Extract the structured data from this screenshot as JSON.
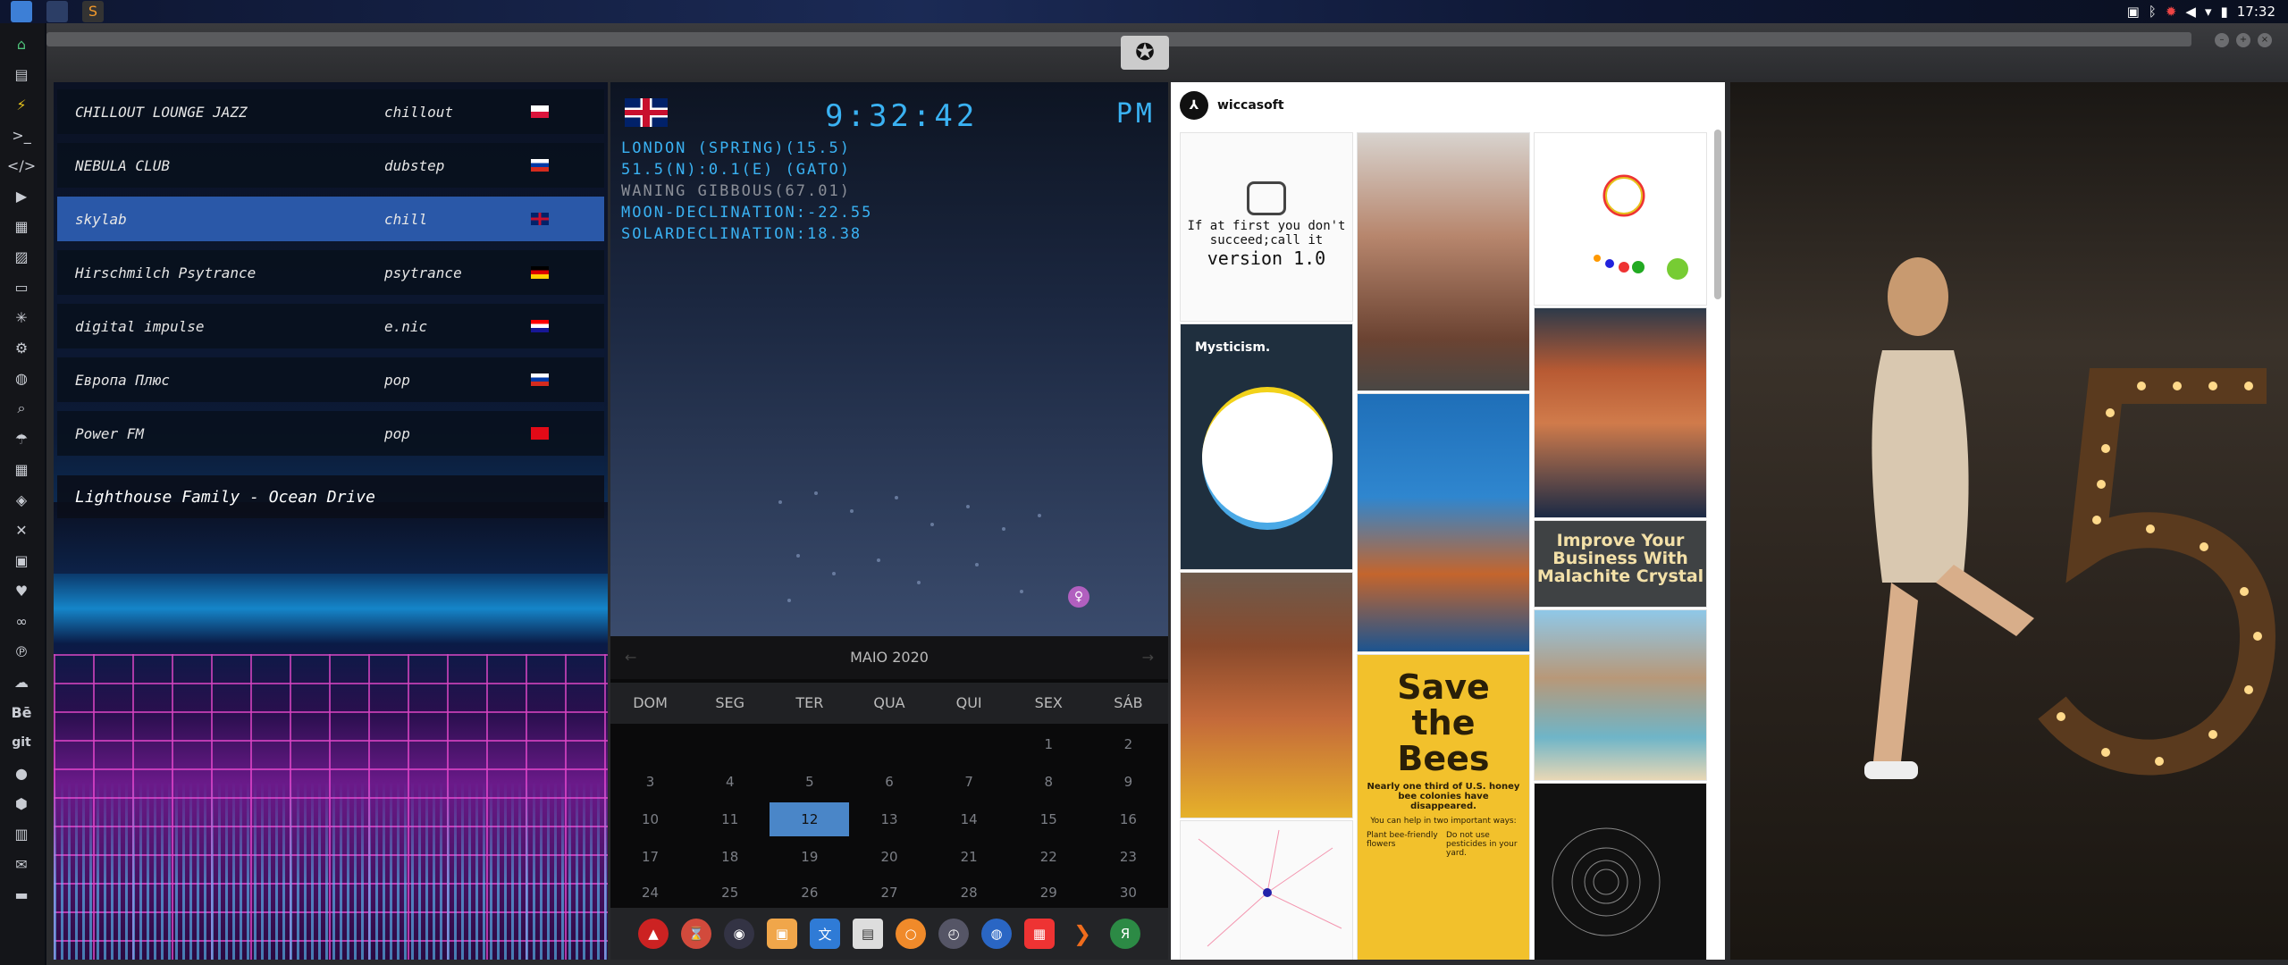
{
  "system": {
    "clock": "17:32",
    "tray_icons": [
      "photos-icon",
      "bluetooth-icon",
      "settings-icon",
      "volume-icon",
      "wifi-icon",
      "battery-icon"
    ]
  },
  "window": {
    "controls": [
      "minimize",
      "maximize",
      "close"
    ]
  },
  "sidebar": {
    "icons": [
      "home-icon",
      "document-icon",
      "bolt-icon",
      "terminal-icon",
      "code-icon",
      "play-icon",
      "video-icon",
      "image-icon",
      "card-icon",
      "star-icon",
      "gear-icon",
      "globe-icon",
      "search-icon",
      "umbrella-icon",
      "grid-icon",
      "tag-icon",
      "expand-icon",
      "youtube-icon",
      "heart-icon",
      "infinity-icon",
      "pinterest-icon",
      "cloud-icon",
      "behance-icon",
      "git-icon",
      "github-icon",
      "cubes-icon",
      "map-icon",
      "mail-icon",
      "bookmark-icon"
    ]
  },
  "radio": {
    "stations": [
      {
        "name": "CHILLOUT LOUNGE JAZZ",
        "genre": "chillout",
        "flag": "pl"
      },
      {
        "name": "NEBULA CLUB",
        "genre": "dubstep",
        "flag": "ru"
      },
      {
        "name": "skylab",
        "genre": "chill",
        "flag": "gb"
      },
      {
        "name": "Hirschmilch Psytrance",
        "genre": "psytrance",
        "flag": "de"
      },
      {
        "name": "digital impulse",
        "genre": "e.nic",
        "flag": "hr"
      },
      {
        "name": "Европа Плюс",
        "genre": "pop",
        "flag": "ru"
      },
      {
        "name": "Power FM",
        "genre": "pop",
        "flag": "tr"
      }
    ],
    "now_playing": "Lighthouse Family - Ocean Drive"
  },
  "clock": {
    "time": "9:32:42",
    "ampm": "PM",
    "lines": [
      "LONDON (SPRING)(15.5)",
      "51.5(N):0.1(E) (GATO)",
      "WANING GIBBOUS(67.01)",
      "MOON-DECLINATION:-22.55",
      "SOLARDECLINATION:18.38"
    ],
    "venus_symbol": "♀"
  },
  "calendar": {
    "month": "MAIO 2020",
    "prev": "←",
    "next": "→",
    "days": [
      "DOM",
      "SEG",
      "TER",
      "QUA",
      "QUI",
      "SEX",
      "SÁB"
    ],
    "weeks": [
      [
        "",
        "",
        "",
        "",
        "",
        "1",
        "2"
      ],
      [
        "3",
        "4",
        "5",
        "6",
        "7",
        "8",
        "9"
      ],
      [
        "10",
        "11",
        "12",
        "13",
        "14",
        "15",
        "16"
      ],
      [
        "17",
        "18",
        "19",
        "20",
        "21",
        "22",
        "23"
      ],
      [
        "24",
        "25",
        "26",
        "27",
        "28",
        "29",
        "30"
      ]
    ],
    "today": "12"
  },
  "dock": {
    "icons": [
      "arch-icon",
      "hourglass-icon",
      "globe-dark-icon",
      "image-viewer-icon",
      "translate-icon",
      "news-icon",
      "search-app-icon",
      "clock-app-icon",
      "browser-icon",
      "calendar-app-icon",
      "arrow-app-icon",
      "yandex-icon"
    ],
    "yandex_label": "Я"
  },
  "pinterest": {
    "user": "wiccasoft",
    "avatar_glyph": "⅄",
    "pins": {
      "first": "If at first you don't succeed;call it",
      "version": "version 1.0",
      "mysticism": "Mysticism.",
      "malachite": "Improve Your Business With Malachite Crystal",
      "bees_title": "Save the Bees",
      "bees_text": "Nearly one third of U.S. honey bee colonies have disappeared.",
      "bees_help": "You can help in two important ways:",
      "bees_1": "Plant bee-friendly flowers",
      "bees_2": "Do not use pesticides in your yard."
    }
  },
  "colors": {
    "accent": "#3ab2f3",
    "selected_station": "#2a58a8",
    "today": "#4a86c8"
  }
}
